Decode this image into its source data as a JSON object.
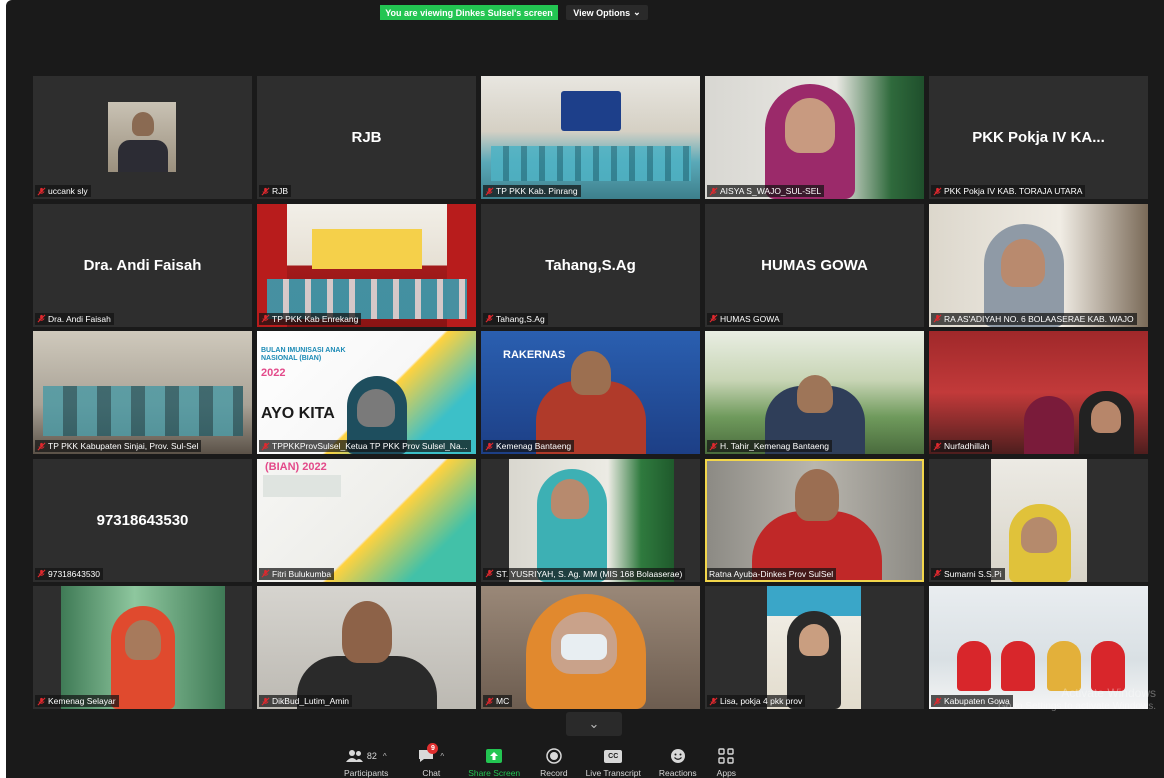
{
  "meeting": {
    "viewing_banner": "You are viewing Dinkes Sulsel's screen",
    "view_options_label": "View Options",
    "view_options_caret": "⌄"
  },
  "tiles": [
    {
      "name": "uccank sly",
      "display": "",
      "kind": "video"
    },
    {
      "name": "RJB",
      "display": "RJB",
      "kind": "name"
    },
    {
      "name": "TP PKK Kab. Pinrang",
      "display": "",
      "kind": "video"
    },
    {
      "name": "AISYA S_WAJO_SUL-SEL",
      "display": "",
      "kind": "video"
    },
    {
      "name": "PKK Pokja IV KAB. TORAJA UTARA",
      "display": "PKK Pokja IV KA...",
      "kind": "name"
    },
    {
      "name": "Dra. Andi Faisah",
      "display": "Dra. Andi Faisah",
      "kind": "name"
    },
    {
      "name": "TP PKK Kab Enrekang",
      "display": "",
      "kind": "video"
    },
    {
      "name": "Tahang,S.Ag",
      "display": "Tahang,S.Ag",
      "kind": "name"
    },
    {
      "name": "HUMAS GOWA",
      "display": "HUMAS GOWA",
      "kind": "name"
    },
    {
      "name": "RA AS'ADIYAH NO. 6 BOLAASERAE KAB. WAJO",
      "display": "",
      "kind": "video"
    },
    {
      "name": "TP PKK Kabupaten Sinjai, Prov. Sul-Sel",
      "display": "",
      "kind": "video"
    },
    {
      "name": "TPPKKProvSulsel_Ketua TP PKK Prov Sulsel_Na...",
      "display": "",
      "kind": "video"
    },
    {
      "name": "Kemenag Bantaeng",
      "display": "",
      "kind": "video"
    },
    {
      "name": "H. Tahir_Kemenag Bantaeng",
      "display": "",
      "kind": "video"
    },
    {
      "name": "Nurfadhillah",
      "display": "",
      "kind": "video"
    },
    {
      "name": "97318643530",
      "display": "97318643530",
      "kind": "name"
    },
    {
      "name": "Fitri Bulukumba",
      "display": "",
      "kind": "video"
    },
    {
      "name": "ST. YUSRIYAH, S. Ag. MM (MIS 168 Bolaaserae)",
      "display": "",
      "kind": "video"
    },
    {
      "name": "Ratna Ayuba-Dinkes Prov SulSel",
      "display": "",
      "kind": "video",
      "active": true
    },
    {
      "name": "Sumarni S.S.Pi",
      "display": "",
      "kind": "video"
    },
    {
      "name": "Kemenag Selayar",
      "display": "",
      "kind": "video"
    },
    {
      "name": "DikBud_Lutim_Amin",
      "display": "",
      "kind": "video"
    },
    {
      "name": "MC",
      "display": "",
      "kind": "video"
    },
    {
      "name": "Lisa, pokja 4 pkk prov",
      "display": "",
      "kind": "video"
    },
    {
      "name": "Kabupaten Gowa",
      "display": "",
      "kind": "video"
    }
  ],
  "video_text": {
    "rakernas": "RAKERNAS",
    "bian_title": "BULAN IMUNISASI ANAK NASIONAL (BIAN)",
    "bian_year": "2022",
    "ayo_kita": "AYO KITA",
    "bian_year_2": "(BIAN) 2022"
  },
  "toolbar": {
    "participants_label": "Participants",
    "participants_count": "82",
    "chat_label": "Chat",
    "chat_badge": "9",
    "share_label": "Share Screen",
    "record_label": "Record",
    "transcript_label": "Live Transcript",
    "transcript_icon_text": "CC",
    "reactions_label": "Reactions",
    "apps_label": "Apps",
    "caret": "^",
    "collapse": "⌄"
  },
  "watermark": {
    "title": "Activate Windows",
    "subtitle": "Go to Settings to activate Windows."
  },
  "colors": {
    "window_bg": "#1a1a1a",
    "tile_bg": "#2e2e2e",
    "banner_green": "#23c552",
    "muted_red": "#e0282e",
    "active_speaker": "#f2d64b"
  }
}
